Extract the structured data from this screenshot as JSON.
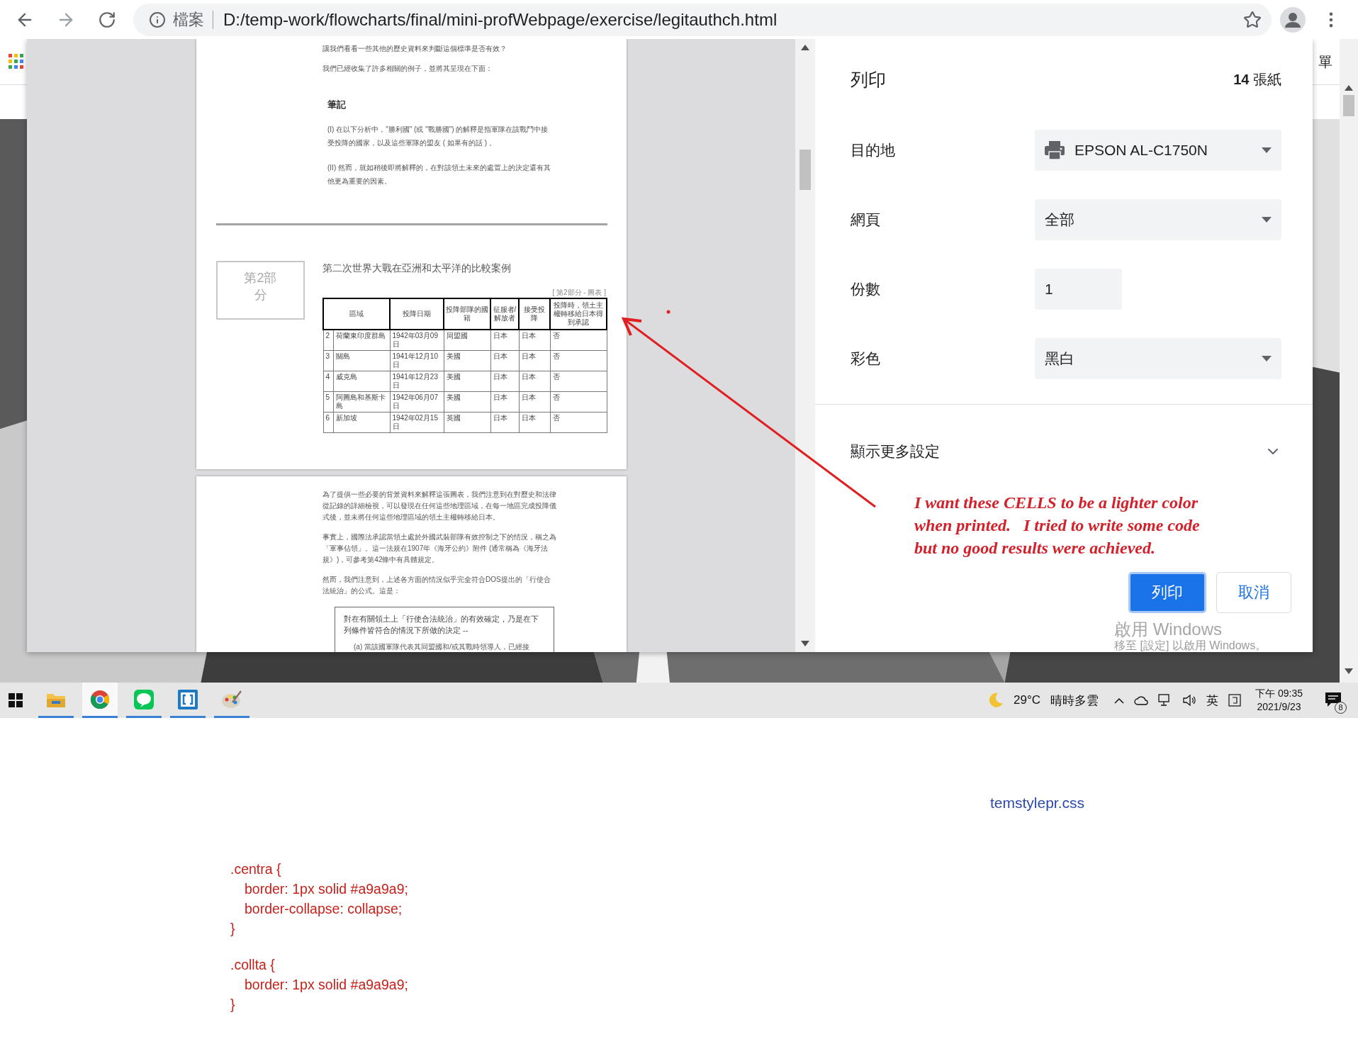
{
  "browser": {
    "site_label": "檔案",
    "url": "D:/temp-work/flowcharts/final/mini-profWebpage/exercise/legitauthch.html"
  },
  "bookmarks_bar": {
    "item": "單"
  },
  "preview": {
    "page_1": {
      "paragraphs": [
        "讓我們看看一些其他的歷史資料來判斷這個標準是否有效？",
        "我們已經收集了許多相關的例子，並將其呈現在下面："
      ],
      "notes_title": "筆記",
      "notes": [
        "(I) 在以下分析中，\"勝利國\" (或 \"戰勝國\") 的解釋是指軍隊在該戰鬥中接受投降的國家，以及這些軍隊的盟友 ( 如果有的話 ) 。",
        "(II) 然而，就如稍後即將解釋的，在對該領土未來的處置上的決定還有其他更為重要的因素。"
      ],
      "section_label": "第2部分",
      "section_title": "第二次世界大戰在亞洲和太平洋的比較案例",
      "table": {
        "caption": "[ 第2部分 - 圖表 ]",
        "columns": [
          "區域",
          "投降日期",
          "投降部隊的國籍",
          "征服者/解放者",
          "接受投降",
          "投降時，領土主權轉移給日本得到承認"
        ],
        "rows": [
          {
            "number": "2",
            "cells": [
              "荷蘭東印度群島",
              "1942年03月09日",
              "同盟國",
              "日本",
              "日本",
              "否"
            ]
          },
          {
            "number": "3",
            "cells": [
              "關島",
              "1941年12月10日",
              "美國",
              "日本",
              "日本",
              "否"
            ]
          },
          {
            "number": "4",
            "cells": [
              "威克島",
              "1941年12月23日",
              "美國",
              "日本",
              "日本",
              "否"
            ]
          },
          {
            "number": "5",
            "cells": [
              "阿圖島和基斯卡島",
              "1942年06月07日",
              "美國",
              "日本",
              "日本",
              "否"
            ]
          },
          {
            "number": "6",
            "cells": [
              "新加坡",
              "1942年02月15日",
              "英國",
              "日本",
              "日本",
              "否"
            ]
          }
        ]
      }
    },
    "page_2": {
      "paragraphs": [
        "為了提供一些必要的背景資料來解釋這張圖表，我們注意到在對歷史和法律從記錄的詳細檢視，可以發現在任何這些地理區域，在每一地區完成投降儀式後，並未將任何這些地理區域的領土主權轉移給日本。",
        "事實上，國際法承認當領土處於外國武裝部隊有效控制之下的情況，稱之為「軍事佔領」。這一法規在1907年《海牙公約》附件 (通常稱為《海牙法規》)，可參考第42條中有具體規定。",
        "然而，我們注意到，上述各方面的情況似乎完全符合DOS提出的「行使合法統治」的公式。這是："
      ],
      "quote": {
        "text": "對在有關領土上「行使合法統治」的有效確定，乃是在下列條件皆符合的情況下所做的決定 --",
        "items": [
          "(a) 當該國軍隊代表其同盟國和/或其戰時領導人，已經接"
        ]
      }
    }
  },
  "print_panel": {
    "title": "列印",
    "sheet_count": "**14** 張紙",
    "settings": [
      {
        "kind": "select",
        "label": "目的地",
        "value": "EPSON AL-C1750N",
        "has_icon": true
      },
      {
        "kind": "select",
        "label": "網頁",
        "value": "全部",
        "has_icon": false
      },
      {
        "kind": "number",
        "label": "份數",
        "value": "1",
        "has_icon": false
      },
      {
        "kind": "select",
        "label": "彩色",
        "value": "黑白",
        "has_icon": false
      }
    ],
    "more_settings": {
      "label": "顯示更多設定",
      "expanded": false
    },
    "buttons": [
      {
        "label": "列印",
        "primary": true
      },
      {
        "label": "取消",
        "primary": false
      }
    ]
  },
  "annotation": {
    "lines": [
      "I want these CELLS to be a lighter color",
      "when printed.   I tried to write some code",
      "but no good results were achieved."
    ]
  },
  "activation_notice": {
    "title": "啟用 Windows",
    "detail": "移至 [設定] 以啟用 Windows。"
  },
  "taskbar": {
    "apps": [
      {
        "kind": "folder",
        "open": true,
        "active": false
      },
      {
        "kind": "browser",
        "open": true,
        "active": true
      },
      {
        "kind": "chat",
        "open": true,
        "active": false
      },
      {
        "kind": "editor",
        "open": true,
        "active": false
      },
      {
        "kind": "paint",
        "open": true,
        "active": false
      }
    ],
    "temperature": "29°C",
    "weather": "晴時多雲",
    "input_language": "英",
    "time": "下午 09:35",
    "date": "2021/9/23",
    "notification_count": "8"
  },
  "stylesheet": {
    "filename": "temstylepr.css",
    "rules": [
      {
        "selector": ".centra {",
        "declarations": [
          "border: 1px solid #a9a9a9;",
          "border-collapse: collapse;"
        ],
        "close": "}"
      },
      {
        "selector": ".collta {",
        "declarations": [
          "border: 1px solid #a9a9a9;"
        ],
        "close": "}"
      }
    ]
  }
}
